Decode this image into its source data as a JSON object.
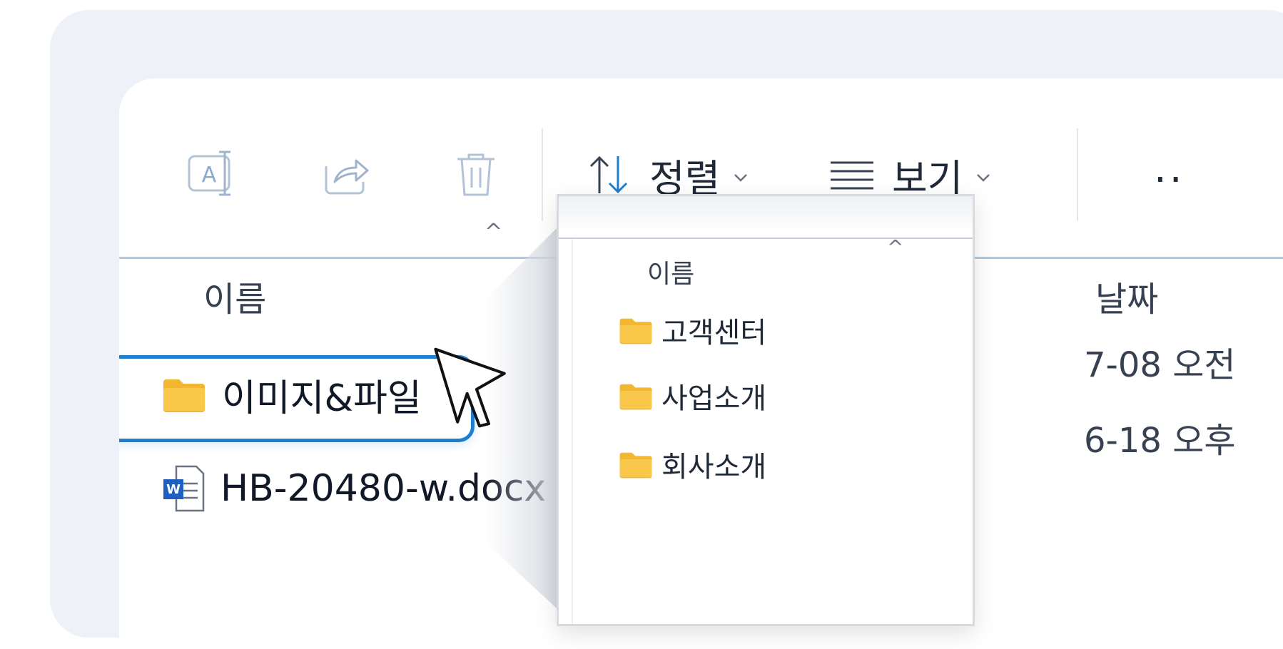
{
  "toolbar": {
    "sort_label": "정렬",
    "view_label": "보기",
    "more_label": "··"
  },
  "columns": {
    "name": "이름",
    "date": "날짜"
  },
  "files": [
    {
      "name": "이미지&파일",
      "type": "folder",
      "date": "7-08 오전",
      "selected": true
    },
    {
      "name": "HB-20480-w.docx",
      "type": "word-document",
      "date": "6-18 오후",
      "selected": false
    }
  ],
  "popup": {
    "column_name": "이름",
    "items": [
      {
        "name": "고객센터"
      },
      {
        "name": "사업소개"
      },
      {
        "name": "회사소개"
      }
    ]
  },
  "icons": {
    "rename": "rename-icon",
    "share": "share-icon",
    "delete": "trash-icon",
    "sort": "sort-arrows-icon",
    "view": "view-list-icon",
    "folder": "folder-icon",
    "word": "word-document-icon",
    "cursor": "mouse-cursor-icon"
  },
  "colors": {
    "accent": "#1d7fcf",
    "folder": "#f2b630",
    "background_card": "#eef1f8"
  }
}
